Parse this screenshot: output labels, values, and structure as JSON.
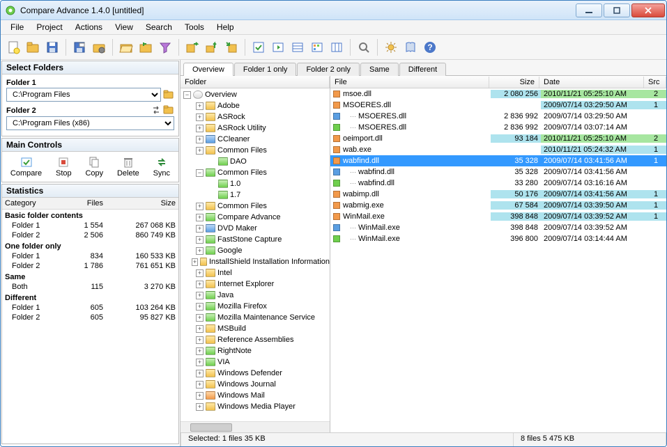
{
  "window": {
    "title": "Compare Advance 1.4.0 [untitled]"
  },
  "menu": [
    "File",
    "Project",
    "Actions",
    "View",
    "Search",
    "Tools",
    "Help"
  ],
  "panels": {
    "select_folders": {
      "title": "Select Folders",
      "f1_label": "Folder 1",
      "f1_value": "C:\\Program Files",
      "f2_label": "Folder 2",
      "f2_value": "C:\\Program Files (x86)"
    },
    "main_controls": {
      "title": "Main Controls",
      "compare": "Compare",
      "stop": "Stop",
      "copy": "Copy",
      "del": "Delete",
      "sync": "Sync"
    },
    "stats": {
      "title": "Statistics",
      "cols": {
        "cat": "Category",
        "files": "Files",
        "size": "Size"
      },
      "groups": [
        {
          "name": "Basic folder contents",
          "rows": [
            {
              "label": "Folder 1",
              "files": "1 554",
              "size": "267 068 KB"
            },
            {
              "label": "Folder 2",
              "files": "2 506",
              "size": "860 749 KB"
            }
          ]
        },
        {
          "name": "One folder only",
          "rows": [
            {
              "label": "Folder 1",
              "files": "834",
              "size": "160 533 KB"
            },
            {
              "label": "Folder 2",
              "files": "1 786",
              "size": "761 651 KB"
            }
          ]
        },
        {
          "name": "Same",
          "rows": [
            {
              "label": "Both",
              "files": "115",
              "size": "3 270 KB"
            }
          ]
        },
        {
          "name": "Different",
          "rows": [
            {
              "label": "Folder 1",
              "files": "605",
              "size": "103 264 KB"
            },
            {
              "label": "Folder 2",
              "files": "605",
              "size": "95 827 KB"
            }
          ]
        }
      ]
    }
  },
  "tabs": [
    "Overview",
    "Folder 1 only",
    "Folder 2 only",
    "Same",
    "Different"
  ],
  "tree_header": "Folder",
  "tree": [
    {
      "depth": 0,
      "exp": "-",
      "color": "root",
      "label": "Overview"
    },
    {
      "depth": 1,
      "exp": "+",
      "color": "yellow",
      "label": "Adobe"
    },
    {
      "depth": 1,
      "exp": "+",
      "color": "yellow",
      "label": "ASRock"
    },
    {
      "depth": 1,
      "exp": "+",
      "color": "yellow",
      "label": "ASRock Utility"
    },
    {
      "depth": 1,
      "exp": "+",
      "color": "blue",
      "label": "CCleaner"
    },
    {
      "depth": 1,
      "exp": "+",
      "color": "yellow",
      "label": "Common Files"
    },
    {
      "depth": 2,
      "exp": "",
      "color": "green",
      "label": "DAO"
    },
    {
      "depth": 1,
      "exp": "-",
      "color": "green",
      "label": "Common Files"
    },
    {
      "depth": 2,
      "exp": "",
      "color": "green",
      "label": "1.0"
    },
    {
      "depth": 2,
      "exp": "",
      "color": "green",
      "label": "1.7"
    },
    {
      "depth": 1,
      "exp": "+",
      "color": "yellow",
      "label": "Common Files"
    },
    {
      "depth": 1,
      "exp": "+",
      "color": "green",
      "label": "Compare Advance"
    },
    {
      "depth": 1,
      "exp": "+",
      "color": "blue",
      "label": "DVD Maker"
    },
    {
      "depth": 1,
      "exp": "+",
      "color": "green",
      "label": "FastStone Capture"
    },
    {
      "depth": 1,
      "exp": "+",
      "color": "green",
      "label": "Google"
    },
    {
      "depth": 1,
      "exp": "+",
      "color": "yellow",
      "label": "InstallShield Installation Information"
    },
    {
      "depth": 1,
      "exp": "+",
      "color": "yellow",
      "label": "Intel"
    },
    {
      "depth": 1,
      "exp": "+",
      "color": "yellow",
      "label": "Internet Explorer"
    },
    {
      "depth": 1,
      "exp": "+",
      "color": "green",
      "label": "Java"
    },
    {
      "depth": 1,
      "exp": "+",
      "color": "green",
      "label": "Mozilla Firefox"
    },
    {
      "depth": 1,
      "exp": "+",
      "color": "green",
      "label": "Mozilla Maintenance Service"
    },
    {
      "depth": 1,
      "exp": "+",
      "color": "yellow",
      "label": "MSBuild"
    },
    {
      "depth": 1,
      "exp": "+",
      "color": "yellow",
      "label": "Reference Assemblies"
    },
    {
      "depth": 1,
      "exp": "+",
      "color": "green",
      "label": "RightNote"
    },
    {
      "depth": 1,
      "exp": "+",
      "color": "green",
      "label": "VIA"
    },
    {
      "depth": 1,
      "exp": "+",
      "color": "yellow",
      "label": "Windows Defender"
    },
    {
      "depth": 1,
      "exp": "+",
      "color": "yellow",
      "label": "Windows Journal"
    },
    {
      "depth": 1,
      "exp": "+",
      "color": "orange",
      "label": "Windows Mail"
    },
    {
      "depth": 1,
      "exp": "+",
      "color": "yellow",
      "label": "Windows Media Player"
    }
  ],
  "file_cols": {
    "file": "File",
    "size": "Size",
    "date": "Date",
    "src": "Src"
  },
  "files": [
    {
      "ico": "orange",
      "ind": 0,
      "name": "msoe.dll",
      "size": "2 080 256",
      "date": "2010/11/21 05:25:10 AM",
      "src": "2",
      "hsize": "cyan",
      "hdate": "green",
      "hsrc": "green"
    },
    {
      "ico": "orange",
      "ind": 0,
      "name": "MSOERES.dll",
      "size": "",
      "date": "2009/07/14 03:29:50 AM",
      "src": "1",
      "hsize": "",
      "hdate": "cyan",
      "hsrc": "cyan"
    },
    {
      "ico": "blue",
      "ind": 1,
      "name": "MSOERES.dll",
      "size": "2 836 992",
      "date": "2009/07/14 03:29:50 AM",
      "src": "",
      "hsize": "",
      "hdate": "",
      "hsrc": ""
    },
    {
      "ico": "green",
      "ind": 1,
      "name": "MSOERES.dll",
      "size": "2 836 992",
      "date": "2009/07/14 03:07:14 AM",
      "src": "",
      "hsize": "",
      "hdate": "",
      "hsrc": ""
    },
    {
      "ico": "orange",
      "ind": 0,
      "name": "oeimport.dll",
      "size": "93 184",
      "date": "2010/11/21 05:25:10 AM",
      "src": "2",
      "hsize": "cyan",
      "hdate": "green",
      "hsrc": "green"
    },
    {
      "ico": "orange",
      "ind": 0,
      "name": "wab.exe",
      "size": "",
      "date": "2010/11/21 05:24:32 AM",
      "src": "1",
      "hsize": "",
      "hdate": "cyan",
      "hsrc": "cyan"
    },
    {
      "ico": "orange",
      "ind": 0,
      "name": "wabfind.dll",
      "size": "35 328",
      "date": "2009/07/14 03:41:56 AM",
      "src": "1",
      "sel": true,
      "hsize": "cyan",
      "hdate": "cyan",
      "hsrc": "cyan"
    },
    {
      "ico": "blue",
      "ind": 1,
      "name": "wabfind.dll",
      "size": "35 328",
      "date": "2009/07/14 03:41:56 AM",
      "src": "",
      "hsize": "",
      "hdate": "",
      "hsrc": ""
    },
    {
      "ico": "green",
      "ind": 1,
      "name": "wabfind.dll",
      "size": "33 280",
      "date": "2009/07/14 03:16:16 AM",
      "src": "",
      "hsize": "",
      "hdate": "",
      "hsrc": ""
    },
    {
      "ico": "orange",
      "ind": 0,
      "name": "wabimp.dll",
      "size": "50 176",
      "date": "2009/07/14 03:41:56 AM",
      "src": "1",
      "hsize": "cyan",
      "hdate": "cyan",
      "hsrc": "cyan"
    },
    {
      "ico": "orange",
      "ind": 0,
      "name": "wabmig.exe",
      "size": "67 584",
      "date": "2009/07/14 03:39:50 AM",
      "src": "1",
      "hsize": "cyan",
      "hdate": "cyan",
      "hsrc": "cyan"
    },
    {
      "ico": "orange",
      "ind": 0,
      "name": "WinMail.exe",
      "size": "398 848",
      "date": "2009/07/14 03:39:52 AM",
      "src": "1",
      "hsize": "cyan",
      "hdate": "cyan",
      "hsrc": "cyan"
    },
    {
      "ico": "blue",
      "ind": 1,
      "name": "WinMail.exe",
      "size": "398 848",
      "date": "2009/07/14 03:39:52 AM",
      "src": "",
      "hsize": "",
      "hdate": "",
      "hsrc": ""
    },
    {
      "ico": "green",
      "ind": 1,
      "name": "WinMail.exe",
      "size": "396 800",
      "date": "2009/07/14 03:14:44 AM",
      "src": "",
      "hsize": "",
      "hdate": "",
      "hsrc": ""
    }
  ],
  "status": {
    "selected": "Selected: 1 files 35 KB",
    "total": "8 files 5 475 KB"
  },
  "toolbar_icons": [
    "new-file-icon",
    "open-folder-icon",
    "save-icon",
    "sep",
    "save-project-icon",
    "project-folder-icon",
    "sep",
    "folder-open-icon",
    "folder-tree-icon",
    "filter-icon",
    "sep",
    "export-right-icon",
    "export-up-icon",
    "import-icon",
    "sep",
    "checkbox-icon",
    "list-right-icon",
    "list-view-icon",
    "grid-view-icon",
    "columns-icon",
    "sep",
    "search-icon",
    "sep",
    "settings-icon",
    "book-icon",
    "help-icon"
  ]
}
